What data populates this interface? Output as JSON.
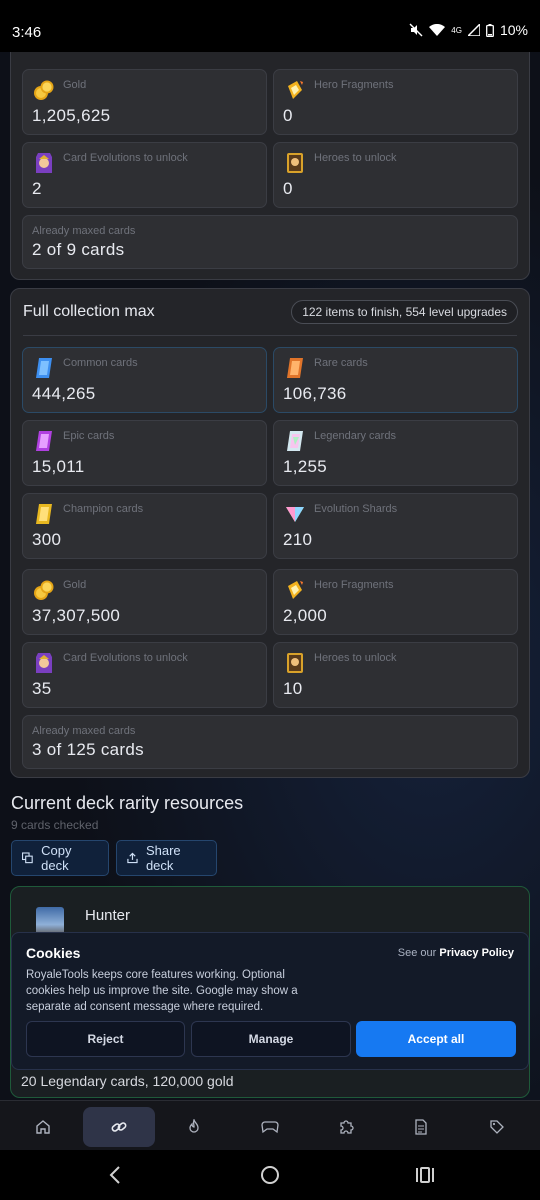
{
  "status_bar": {
    "time": "3:46",
    "network": "4G",
    "battery": "10%"
  },
  "top_panel": {
    "tiles": [
      {
        "label": "Gold",
        "value": "1,205,625",
        "icon": "gold-coins-icon"
      },
      {
        "label": "Hero Fragments",
        "value": "0",
        "icon": "hero-fragment-icon"
      },
      {
        "label": "Card Evolutions to unlock",
        "value": "2",
        "icon": "card-evolution-icon"
      },
      {
        "label": "Heroes to unlock",
        "value": "0",
        "icon": "hero-card-icon"
      }
    ],
    "maxed": {
      "label": "Already maxed cards",
      "value": "2 of 9 cards"
    }
  },
  "full_collection": {
    "title": "Full collection max",
    "pill": "122 items to finish, 554 level upgrades",
    "tiles": [
      {
        "label": "Common cards",
        "value": "444,265",
        "icon": "common-card-icon"
      },
      {
        "label": "Rare cards",
        "value": "106,736",
        "icon": "rare-card-icon"
      },
      {
        "label": "Epic cards",
        "value": "15,011",
        "icon": "epic-card-icon"
      },
      {
        "label": "Legendary cards",
        "value": "1,255",
        "icon": "legendary-card-icon"
      },
      {
        "label": "Champion cards",
        "value": "300",
        "icon": "champion-card-icon"
      },
      {
        "label": "Evolution Shards",
        "value": "210",
        "icon": "evolution-shard-icon"
      },
      {
        "label": "Gold",
        "value": "37,307,500",
        "icon": "gold-coins-icon"
      },
      {
        "label": "Hero Fragments",
        "value": "2,000",
        "icon": "hero-fragment-icon"
      },
      {
        "label": "Card Evolutions to unlock",
        "value": "35",
        "icon": "card-evolution-icon"
      },
      {
        "label": "Heroes to unlock",
        "value": "10",
        "icon": "hero-card-icon"
      }
    ],
    "maxed": {
      "label": "Already maxed cards",
      "value": "3 of 125 cards"
    }
  },
  "deck_section": {
    "title": "Current deck rarity resources",
    "subtitle": "9 cards checked",
    "copy_label": "Copy deck",
    "share_label": "Share deck",
    "card_name": "Hunter",
    "summary": "20 Legendary cards, 120,000 gold"
  },
  "cookie_banner": {
    "title": "Cookies",
    "policy_prefix": "See our",
    "policy_link": "Privacy Policy",
    "text": "RoyaleTools keeps core features working. Optional cookies help us improve the site. Google may show a separate ad consent message where required.",
    "reject": "Reject",
    "manage": "Manage",
    "accept": "Accept all",
    "accent": "#1679f2"
  },
  "bottom_nav": {
    "items": [
      "home-icon",
      "link-icon",
      "flame-icon",
      "gamepad-icon",
      "puzzle-icon",
      "document-icon",
      "tag-icon"
    ],
    "active_index": 1
  }
}
